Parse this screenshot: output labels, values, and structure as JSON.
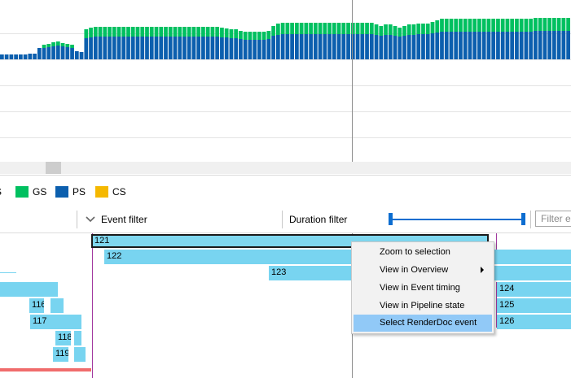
{
  "perf_chart": {
    "series": [
      {
        "name": "GS",
        "color": "#00c060"
      },
      {
        "name": "PS",
        "color": "#0c5fae"
      }
    ],
    "bars": [
      {
        "ps": 6,
        "gs": 0
      },
      {
        "ps": 6,
        "gs": 0
      },
      {
        "ps": 6,
        "gs": 0
      },
      {
        "ps": 6,
        "gs": 0
      },
      {
        "ps": 6,
        "gs": 0
      },
      {
        "ps": 6,
        "gs": 0
      },
      {
        "ps": 7,
        "gs": 0
      },
      {
        "ps": 7,
        "gs": 0
      },
      {
        "ps": 14,
        "gs": 0
      },
      {
        "ps": 14,
        "gs": 4
      },
      {
        "ps": 15,
        "gs": 4
      },
      {
        "ps": 16,
        "gs": 5
      },
      {
        "ps": 17,
        "gs": 5
      },
      {
        "ps": 16,
        "gs": 4
      },
      {
        "ps": 15,
        "gs": 4
      },
      {
        "ps": 14,
        "gs": 4
      },
      {
        "ps": 10,
        "gs": 0
      },
      {
        "ps": 9,
        "gs": 0
      },
      {
        "ps": 26,
        "gs": 11
      },
      {
        "ps": 27,
        "gs": 12
      },
      {
        "ps": 28,
        "gs": 12
      },
      {
        "ps": 28,
        "gs": 12
      },
      {
        "ps": 28,
        "gs": 12
      },
      {
        "ps": 28,
        "gs": 12
      },
      {
        "ps": 28,
        "gs": 12
      },
      {
        "ps": 28,
        "gs": 12
      },
      {
        "ps": 28,
        "gs": 12
      },
      {
        "ps": 28,
        "gs": 12
      },
      {
        "ps": 28,
        "gs": 12
      },
      {
        "ps": 28,
        "gs": 12
      },
      {
        "ps": 28,
        "gs": 12
      },
      {
        "ps": 28,
        "gs": 12
      },
      {
        "ps": 28,
        "gs": 12
      },
      {
        "ps": 28,
        "gs": 12
      },
      {
        "ps": 28,
        "gs": 12
      },
      {
        "ps": 28,
        "gs": 12
      },
      {
        "ps": 28,
        "gs": 12
      },
      {
        "ps": 28,
        "gs": 12
      },
      {
        "ps": 28,
        "gs": 12
      },
      {
        "ps": 28,
        "gs": 12
      },
      {
        "ps": 28,
        "gs": 12
      },
      {
        "ps": 28,
        "gs": 12
      },
      {
        "ps": 28,
        "gs": 12
      },
      {
        "ps": 28,
        "gs": 12
      },
      {
        "ps": 28,
        "gs": 12
      },
      {
        "ps": 28,
        "gs": 12
      },
      {
        "ps": 28,
        "gs": 12
      },
      {
        "ps": 27,
        "gs": 12
      },
      {
        "ps": 27,
        "gs": 11
      },
      {
        "ps": 26,
        "gs": 11
      },
      {
        "ps": 26,
        "gs": 11
      },
      {
        "ps": 25,
        "gs": 10
      },
      {
        "ps": 24,
        "gs": 10
      },
      {
        "ps": 24,
        "gs": 10
      },
      {
        "ps": 24,
        "gs": 10
      },
      {
        "ps": 24,
        "gs": 10
      },
      {
        "ps": 24,
        "gs": 10
      },
      {
        "ps": 25,
        "gs": 10
      },
      {
        "ps": 29,
        "gs": 12
      },
      {
        "ps": 30,
        "gs": 14
      },
      {
        "ps": 31,
        "gs": 14
      },
      {
        "ps": 31,
        "gs": 14
      },
      {
        "ps": 31,
        "gs": 14
      },
      {
        "ps": 31,
        "gs": 14
      },
      {
        "ps": 31,
        "gs": 14
      },
      {
        "ps": 31,
        "gs": 14
      },
      {
        "ps": 31,
        "gs": 14
      },
      {
        "ps": 31,
        "gs": 14
      },
      {
        "ps": 31,
        "gs": 14
      },
      {
        "ps": 31,
        "gs": 14
      },
      {
        "ps": 31,
        "gs": 14
      },
      {
        "ps": 31,
        "gs": 14
      },
      {
        "ps": 31,
        "gs": 14
      },
      {
        "ps": 31,
        "gs": 14
      },
      {
        "ps": 31,
        "gs": 14
      },
      {
        "ps": 31,
        "gs": 14
      },
      {
        "ps": 31,
        "gs": 14
      },
      {
        "ps": 31,
        "gs": 14
      },
      {
        "ps": 31,
        "gs": 14
      },
      {
        "ps": 31,
        "gs": 14
      },
      {
        "ps": 30,
        "gs": 13
      },
      {
        "ps": 29,
        "gs": 12
      },
      {
        "ps": 30,
        "gs": 13
      },
      {
        "ps": 30,
        "gs": 13
      },
      {
        "ps": 29,
        "gs": 12
      },
      {
        "ps": 28,
        "gs": 11
      },
      {
        "ps": 29,
        "gs": 12
      },
      {
        "ps": 30,
        "gs": 13
      },
      {
        "ps": 30,
        "gs": 13
      },
      {
        "ps": 31,
        "gs": 13
      },
      {
        "ps": 31,
        "gs": 13
      },
      {
        "ps": 31,
        "gs": 13
      },
      {
        "ps": 32,
        "gs": 14
      },
      {
        "ps": 33,
        "gs": 15
      },
      {
        "ps": 34,
        "gs": 16
      },
      {
        "ps": 34,
        "gs": 16
      },
      {
        "ps": 34,
        "gs": 16
      },
      {
        "ps": 34,
        "gs": 16
      },
      {
        "ps": 34,
        "gs": 16
      },
      {
        "ps": 34,
        "gs": 16
      },
      {
        "ps": 34,
        "gs": 16
      },
      {
        "ps": 34,
        "gs": 16
      },
      {
        "ps": 34,
        "gs": 16
      },
      {
        "ps": 34,
        "gs": 16
      },
      {
        "ps": 34,
        "gs": 16
      },
      {
        "ps": 34,
        "gs": 16
      },
      {
        "ps": 34,
        "gs": 16
      },
      {
        "ps": 34,
        "gs": 16
      },
      {
        "ps": 34,
        "gs": 16
      },
      {
        "ps": 34,
        "gs": 16
      },
      {
        "ps": 34,
        "gs": 16
      },
      {
        "ps": 34,
        "gs": 16
      },
      {
        "ps": 34,
        "gs": 16
      },
      {
        "ps": 34,
        "gs": 16
      },
      {
        "ps": 35,
        "gs": 16
      },
      {
        "ps": 35,
        "gs": 16
      },
      {
        "ps": 35,
        "gs": 16
      },
      {
        "ps": 35,
        "gs": 16
      },
      {
        "ps": 35,
        "gs": 16
      },
      {
        "ps": 35,
        "gs": 16
      },
      {
        "ps": 35,
        "gs": 16
      },
      {
        "ps": 35,
        "gs": 16
      }
    ]
  },
  "legend": {
    "items": [
      {
        "label": "S",
        "color": "#00c060"
      },
      {
        "label": "GS",
        "color": "#00c060"
      },
      {
        "label": "PS",
        "color": "#0c5fae"
      },
      {
        "label": "CS",
        "color": "#f5b800"
      }
    ]
  },
  "filterbar": {
    "event_filter_label": "Event filter",
    "duration_filter_label": "Duration filter",
    "filter_placeholder": "Filter e",
    "duration_range": [
      0.0,
      1.0
    ]
  },
  "events": {
    "e121": "121",
    "e122": "122",
    "e123": "123",
    "e124": "124",
    "e125": "125",
    "e126": "126",
    "e116": "116",
    "e117": "117",
    "e118": "118",
    "e119": "119"
  },
  "context_menu": {
    "items": [
      {
        "label": "Zoom to selection"
      },
      {
        "label": "View in Overview"
      },
      {
        "label": "View in Event timing"
      },
      {
        "label": "View in Pipeline state"
      },
      {
        "label": "Select RenderDoc event"
      }
    ]
  }
}
